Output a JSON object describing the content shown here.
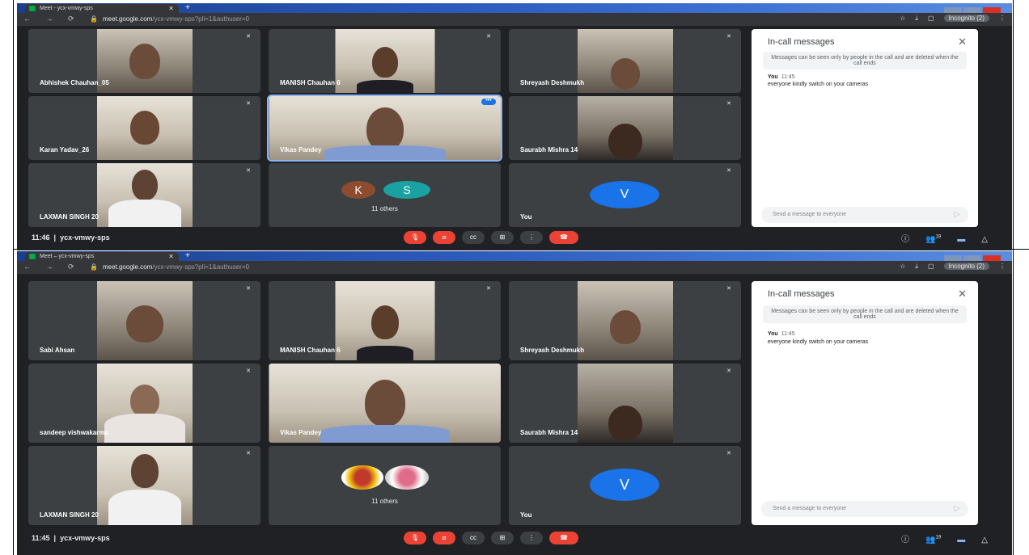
{
  "colors": {
    "meet_background": "#202124",
    "tile_background": "#3c4043",
    "active_outline": "#8ab4f8",
    "hangup_red": "#ea4335",
    "avatar_k": "#8d4b2f",
    "avatar_s": "#1aa2a2",
    "avatar_v": "#1a73e8"
  },
  "screenshots": [
    {
      "browser": {
        "tab_title": "Meet - ycx-vmwy-sps",
        "url_host": "meet.google.com",
        "url_path": "/ycx-vmwy-sps?pli=1&authuser=0",
        "incognito_label": "Incognito (2)"
      },
      "tiles": [
        {
          "name": "Abhishek Chauhan_05"
        },
        {
          "name": "MANISH Chauhan 6"
        },
        {
          "name": "Shreyash Deshmukh"
        },
        {
          "name": "Karan Yadav_26"
        },
        {
          "name": "Vikas Pandey"
        },
        {
          "name": "Saurabh Mishra 14"
        },
        {
          "name": "LAXMAN SINGH 20"
        },
        {
          "name": "",
          "avatars": [
            "K",
            "S"
          ],
          "others": "11 others"
        },
        {
          "name": "You",
          "avatar": "V"
        }
      ],
      "panel": {
        "title": "In-call messages",
        "notice": "Messages can be seen only by people in the call and are deleted when the call ends",
        "sender": "You",
        "time": "11:45",
        "message": "everyone kindly switch on your cameras",
        "input_placeholder": "Send a message to everyone"
      },
      "bottom": {
        "time": "11:46",
        "meeting_code": "ycx-vmwy-sps",
        "participants_badge": "19"
      }
    },
    {
      "browser": {
        "tab_title": "Meet – ycx-vmwy-sps",
        "url_host": "meet.google.com",
        "url_path": "/ycx-vmwy-sps?pli=1&authuser=0",
        "incognito_label": "Incognito (2)"
      },
      "tiles": [
        {
          "name": "Sabi Ahsan"
        },
        {
          "name": "MANISH Chauhan 6"
        },
        {
          "name": "Shreyash Deshmukh"
        },
        {
          "name": "sandeep vishwakarma"
        },
        {
          "name": "Vikas Pandey"
        },
        {
          "name": "Saurabh Mishra 14"
        },
        {
          "name": "LAXMAN SINGH 20"
        },
        {
          "name": "",
          "others": "11 others"
        },
        {
          "name": "You",
          "avatar": "V"
        }
      ],
      "panel": {
        "title": "In-call messages",
        "notice": "Messages can be seen only by people in the call and are deleted when the call ends",
        "sender": "You",
        "time": "11:45",
        "message": "everyone kindly switch on your cameras",
        "input_placeholder": "Send a message to everyone"
      },
      "bottom": {
        "time": "11:45",
        "meeting_code": "ycx-vmwy-sps",
        "participants_badge": "19"
      }
    }
  ]
}
